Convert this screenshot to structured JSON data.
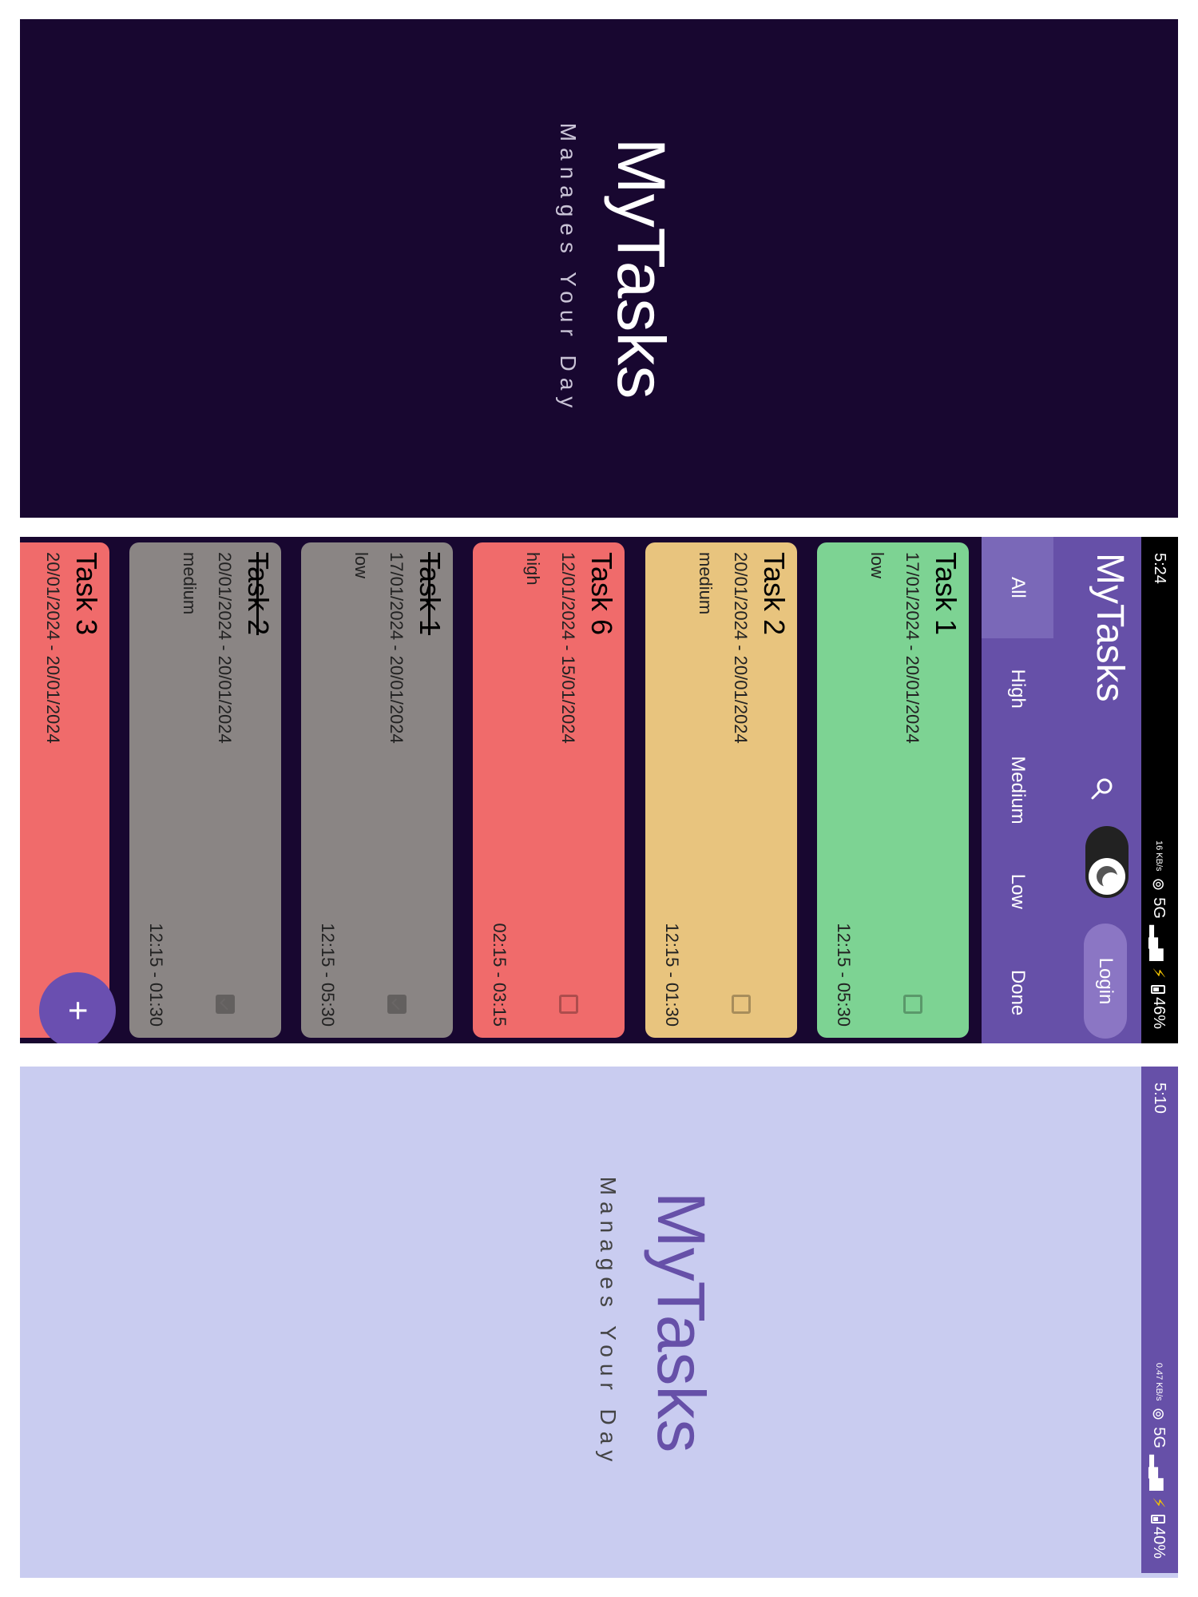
{
  "splash_dark": {
    "title": "MyTasks",
    "subtitle": "Manages Your Day"
  },
  "task_screen": {
    "status_bar": {
      "time": "5:24",
      "net_speed": "16 KB/s",
      "network": "5G",
      "battery": "46%",
      "battery_level": 0.46
    },
    "app_title": "MyTasks",
    "search_icon": "search-icon",
    "theme_toggle": {
      "state": "dark",
      "icon": "moon-icon"
    },
    "login_label": "Login",
    "tabs": [
      "All",
      "High",
      "Medium",
      "Low",
      "Done"
    ],
    "active_tab": "All",
    "tasks": [
      {
        "title": "Task 1",
        "dates": "17/01/2024 - 20/01/2024",
        "priority": "low",
        "time": "12:15 - 05:30",
        "done": false,
        "color": "#7dd393"
      },
      {
        "title": "Task 2",
        "dates": "20/01/2024 - 20/01/2024",
        "priority": "medium",
        "time": "12:15 - 01:30",
        "done": false,
        "color": "#e8c47e"
      },
      {
        "title": "Task 6",
        "dates": "12/01/2024 - 15/01/2024",
        "priority": "high",
        "time": "02:15 - 03:15",
        "done": false,
        "color": "#f06b6b"
      },
      {
        "title": "Task 1",
        "dates": "17/01/2024 - 20/01/2024",
        "priority": "low",
        "time": "12:15 - 05:30",
        "done": true,
        "color": "#8a8584"
      },
      {
        "title": "Task 2",
        "dates": "20/01/2024 - 20/01/2024",
        "priority": "medium",
        "time": "12:15 - 01:30",
        "done": true,
        "color": "#8a8584"
      },
      {
        "title": "Task 3",
        "dates": "20/01/2024 - 20/01/2024",
        "priority": "",
        "time": "",
        "done": false,
        "color": "#f06b6b"
      }
    ],
    "fab_label": "+"
  },
  "splash_light": {
    "status_bar": {
      "time": "5:10",
      "net_speed": "0.47 KB/s",
      "network": "5G",
      "battery": "40%",
      "battery_level": 0.4
    },
    "title": "MyTasks",
    "subtitle": "Manages Your Day"
  },
  "colors": {
    "dark_bg": "#180730",
    "accent": "#6650a8",
    "light_bg": "#c9ccf0"
  }
}
